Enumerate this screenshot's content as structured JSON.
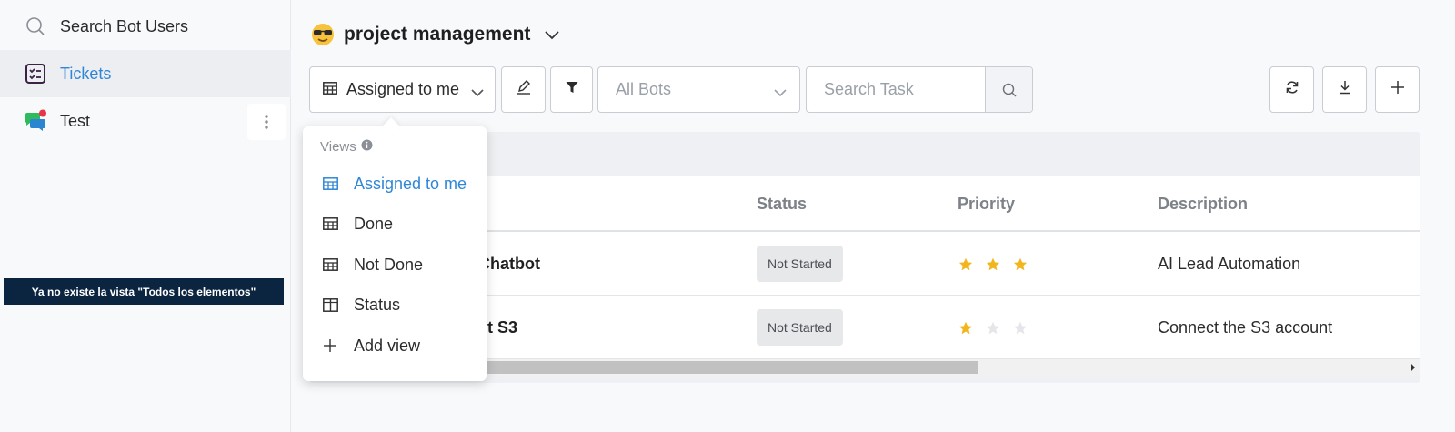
{
  "sidebar": {
    "items": [
      {
        "label": "Search Bot Users",
        "icon": "search-icon"
      },
      {
        "label": "Tickets",
        "icon": "checklist-icon"
      },
      {
        "label": "Test",
        "icon": "chat-bubbles-icon"
      }
    ],
    "tooltip": "Ya no existe la vista \"Todos los elementos\""
  },
  "header": {
    "project_title": "project management",
    "emoji_icon": "sunglasses-emoji-icon"
  },
  "toolbar": {
    "view_label": "Assigned to me",
    "bots_placeholder": "All Bots",
    "search_placeholder": "Search Task"
  },
  "views_menu": {
    "header": "Views",
    "items": [
      {
        "label": "Assigned to me",
        "active": true
      },
      {
        "label": "Done"
      },
      {
        "label": "Not Done"
      },
      {
        "label": "Status"
      },
      {
        "label": "Add view"
      }
    ]
  },
  "table": {
    "columns": [
      "Status",
      "Priority",
      "Description"
    ],
    "rows": [
      {
        "name": "Chatbot",
        "status": "Not Started",
        "priority": 3,
        "description": "AI Lead Automation"
      },
      {
        "name": "ct S3",
        "status": "Not Started",
        "priority": 1,
        "description": "Connect the S3 account"
      }
    ],
    "max_priority": 3
  },
  "colors": {
    "accent": "#2f86d6",
    "star_on": "#f2b51e",
    "star_off": "#e4e6e9",
    "tooltip_bg": "#0b2440"
  }
}
